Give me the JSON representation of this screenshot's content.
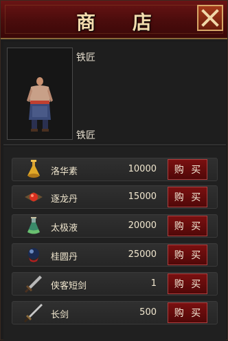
{
  "window": {
    "title": "商 店"
  },
  "npc": {
    "name_top": "铁匠",
    "name_bottom": "铁匠"
  },
  "items": [
    {
      "name": "洛华素",
      "price": "10000",
      "buy_label": "购 买",
      "icon": "gold-flask-icon"
    },
    {
      "name": "逐龙丹",
      "price": "15000",
      "buy_label": "购 买",
      "icon": "red-orb-pill-icon"
    },
    {
      "name": "太极液",
      "price": "20000",
      "buy_label": "购 买",
      "icon": "green-potion-flask-icon"
    },
    {
      "name": "桂圆丹",
      "price": "25000",
      "buy_label": "购 买",
      "icon": "dark-orb-pill-icon"
    },
    {
      "name": "侠客短剑",
      "price": "1",
      "buy_label": "购 买",
      "icon": "short-sword-icon"
    },
    {
      "name": "长剑",
      "price": "500",
      "buy_label": "购 买",
      "icon": "long-sword-icon"
    }
  ],
  "colors": {
    "title_bar": "#5a1010",
    "buy_button": "#6a0e0e",
    "text": "#f2e8d0"
  }
}
